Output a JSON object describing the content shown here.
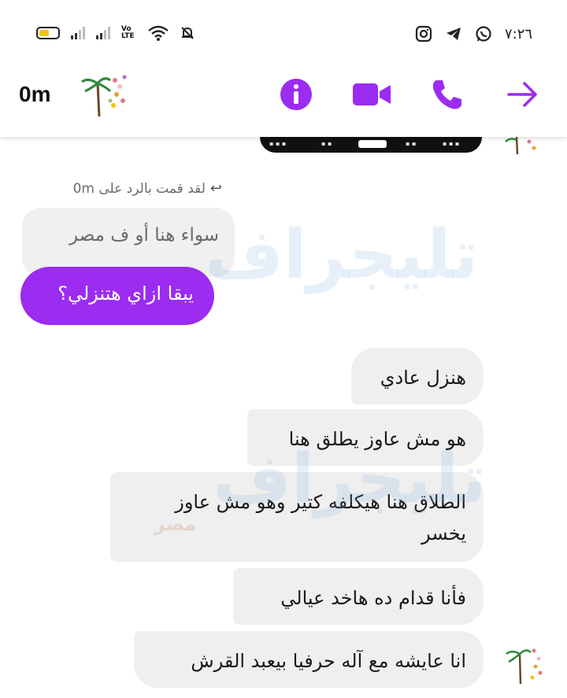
{
  "status_bar": {
    "time": "٧:٢٦",
    "volte_label": "Vo LTE",
    "icons": [
      "battery-icon",
      "signal-icon",
      "signal-icon",
      "volte-icon",
      "wifi-icon",
      "mute-bell-icon",
      "instagram-icon",
      "telegram-icon",
      "whatsapp-icon"
    ]
  },
  "header": {
    "contact_name": "0m",
    "actions": [
      "info-icon",
      "video-call-icon",
      "phone-call-icon",
      "forward-arrow-icon"
    ],
    "accent_color": "#9b2cf0"
  },
  "chat": {
    "reply_note": "لقد قمت بالرد على 0m",
    "quoted_message": "سواء هنا أو ف مصر",
    "my_message": "يبقا ازاي هتنزلي؟",
    "messages": [
      "هنزل عادي",
      "هو مش عاوز يطلق هنا",
      "الطلاق هنا هيكلفه كتير وهو مش عاوز يخسر",
      "فأنا قدام ده هاخد عيالي",
      "انا عايشه مع آله حرفيا بيعبد القرش"
    ]
  },
  "watermark": {
    "text": "تليجراف",
    "sub": "مصر"
  }
}
